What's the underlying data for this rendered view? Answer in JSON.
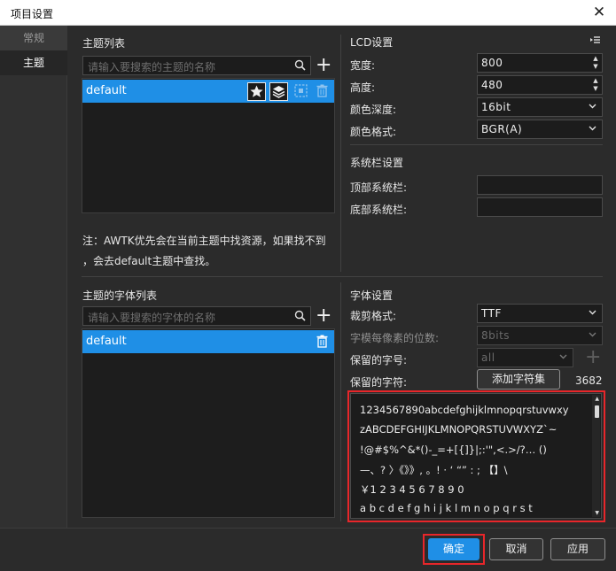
{
  "window": {
    "title": "项目设置",
    "close": "✕"
  },
  "sidebar": {
    "items": [
      {
        "label": "常规"
      },
      {
        "label": "主题"
      }
    ]
  },
  "themes": {
    "heading": "主题列表",
    "search_placeholder": "请输入要搜索的主题的名称",
    "items": [
      {
        "name": "default"
      }
    ],
    "note_line1": "注：AWTK优先会在当前主题中找资源，如果找不到",
    "note_line2": "，会去default主题中查找。"
  },
  "lcd": {
    "heading": "LCD设置",
    "width_label": "宽度:",
    "width_value": "800",
    "height_label": "高度:",
    "height_value": "480",
    "depth_label": "颜色深度:",
    "depth_value": "16bit",
    "format_label": "颜色格式:",
    "format_value": "BGR(A)"
  },
  "system_bar": {
    "heading": "系统栏设置",
    "top_label": "顶部系统栏:",
    "top_value": "",
    "bottom_label": "底部系统栏:",
    "bottom_value": ""
  },
  "fonts": {
    "heading": "主题的字体列表",
    "search_placeholder": "请输入要搜索的字体的名称",
    "items": [
      {
        "name": "default"
      }
    ]
  },
  "font_settings": {
    "heading": "字体设置",
    "crop_label": "裁剪格式:",
    "crop_value": "TTF",
    "bpp_label": "字模每像素的位数:",
    "bpp_value": "8bits",
    "reserved_size_label": "保留的字号:",
    "reserved_size_value": "all",
    "reserved_chars_label": "保留的字符:",
    "add_charset_button": "添加字符集",
    "char_count": "3682",
    "char_lines": [
      "1234567890abcdefghijklmnopqrstuvwxy",
      "zABCDEFGHIJKLMNOPQRSTUVWXYZ`~",
      "!@#$%^&*()-_=+[{]}|;:'\",<.>/?… ()",
      "—、? 〉《》》, 。! · ‘  “” : ; 【】\\",
      "￥1 2 3 4 5 6 7 8 9 0",
      "a b c d e f g h i j k l m n o p q r s t"
    ]
  },
  "footer": {
    "ok": "确定",
    "cancel": "取消",
    "apply": "应用"
  },
  "colors": {
    "accent": "#1f8fe6",
    "highlight": "#e8262a",
    "background": "#2b2b2b"
  },
  "icons": [
    "close-icon",
    "search-icon",
    "plus-icon",
    "star-icon",
    "layers-icon",
    "select-icon",
    "trash-icon",
    "menu-icon",
    "chevron-down-icon",
    "spin-arrows-icon"
  ]
}
